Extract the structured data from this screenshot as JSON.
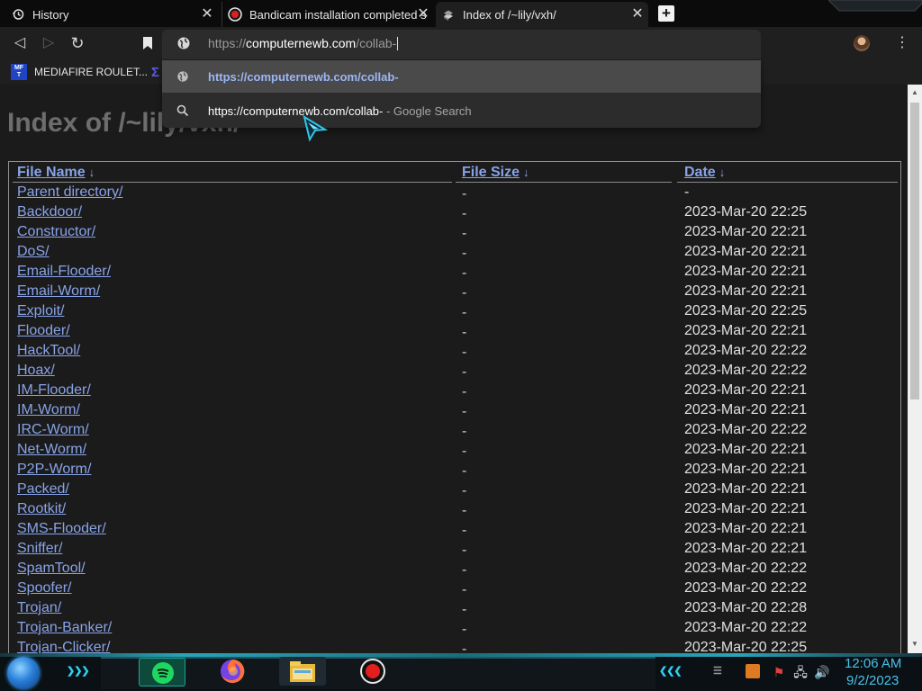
{
  "tabs": [
    {
      "label": "History",
      "icon": "history-icon",
      "close": "✕"
    },
    {
      "label": "Bandicam installation completed s",
      "icon": "bandicam-icon",
      "close": "✕"
    },
    {
      "label": "Index of /~lily/vxh/",
      "icon": "site-favicon-icon",
      "close": "✕"
    }
  ],
  "new_tab": "+",
  "toolbar": {
    "back": "◁",
    "forward": "▷",
    "reload": "↻",
    "menu": "⋮"
  },
  "address_bar": {
    "scheme": "https://",
    "host": "computernewb.com",
    "path": "/collab-"
  },
  "bookmarks": [
    {
      "label": "MEDIAFIRE ROULET...",
      "icon_text": "MF\nT"
    },
    {
      "label": "Σ"
    }
  ],
  "omnibox": {
    "suggestions": [
      {
        "text": "https://computernewb.com/collab-",
        "icon": "globe-icon"
      },
      {
        "text": "https://computernewb.com/collab-",
        "suffix": " - Google Search",
        "icon": "search-icon"
      }
    ]
  },
  "page": {
    "title": "Index of /~lily/vxh/",
    "columns": [
      {
        "label": "File Name",
        "sort": "↓"
      },
      {
        "label": "File Size",
        "sort": "↓"
      },
      {
        "label": "Date",
        "sort": "↓"
      }
    ],
    "rows": [
      {
        "name": "Parent directory/",
        "size": "-",
        "date": "-"
      },
      {
        "name": "Backdoor/",
        "size": "-",
        "date": "2023-Mar-20 22:25"
      },
      {
        "name": "Constructor/",
        "size": "-",
        "date": "2023-Mar-20 22:21"
      },
      {
        "name": "DoS/",
        "size": "-",
        "date": "2023-Mar-20 22:21"
      },
      {
        "name": "Email-Flooder/",
        "size": "-",
        "date": "2023-Mar-20 22:21"
      },
      {
        "name": "Email-Worm/",
        "size": "-",
        "date": "2023-Mar-20 22:21"
      },
      {
        "name": "Exploit/",
        "size": "-",
        "date": "2023-Mar-20 22:25"
      },
      {
        "name": "Flooder/",
        "size": "-",
        "date": "2023-Mar-20 22:21"
      },
      {
        "name": "HackTool/",
        "size": "-",
        "date": "2023-Mar-20 22:22"
      },
      {
        "name": "Hoax/",
        "size": "-",
        "date": "2023-Mar-20 22:22"
      },
      {
        "name": "IM-Flooder/",
        "size": "-",
        "date": "2023-Mar-20 22:21"
      },
      {
        "name": "IM-Worm/",
        "size": "-",
        "date": "2023-Mar-20 22:21"
      },
      {
        "name": "IRC-Worm/",
        "size": "-",
        "date": "2023-Mar-20 22:22"
      },
      {
        "name": "Net-Worm/",
        "size": "-",
        "date": "2023-Mar-20 22:21"
      },
      {
        "name": "P2P-Worm/",
        "size": "-",
        "date": "2023-Mar-20 22:21"
      },
      {
        "name": "Packed/",
        "size": "-",
        "date": "2023-Mar-20 22:21"
      },
      {
        "name": "Rootkit/",
        "size": "-",
        "date": "2023-Mar-20 22:21"
      },
      {
        "name": "SMS-Flooder/",
        "size": "-",
        "date": "2023-Mar-20 22:21"
      },
      {
        "name": "Sniffer/",
        "size": "-",
        "date": "2023-Mar-20 22:21"
      },
      {
        "name": "SpamTool/",
        "size": "-",
        "date": "2023-Mar-20 22:22"
      },
      {
        "name": "Spoofer/",
        "size": "-",
        "date": "2023-Mar-20 22:22"
      },
      {
        "name": "Trojan/",
        "size": "-",
        "date": "2023-Mar-20 22:28"
      },
      {
        "name": "Trojan-Banker/",
        "size": "-",
        "date": "2023-Mar-20 22:22"
      },
      {
        "name": "Trojan-Clicker/",
        "size": "-",
        "date": "2023-Mar-20 22:25"
      }
    ]
  },
  "taskbar": {
    "apps": [
      "spotify-icon",
      "firefox-icon",
      "file-explorer-icon",
      "bandicam-record-icon"
    ],
    "clock_time": "12:06 AM",
    "clock_date": "9/2/2023"
  },
  "colors": {
    "link": "#88a3e8",
    "page_bg": "#1b1b1b",
    "clock": "#4ac0e8",
    "accent_cyan": "#2aa4b8"
  }
}
